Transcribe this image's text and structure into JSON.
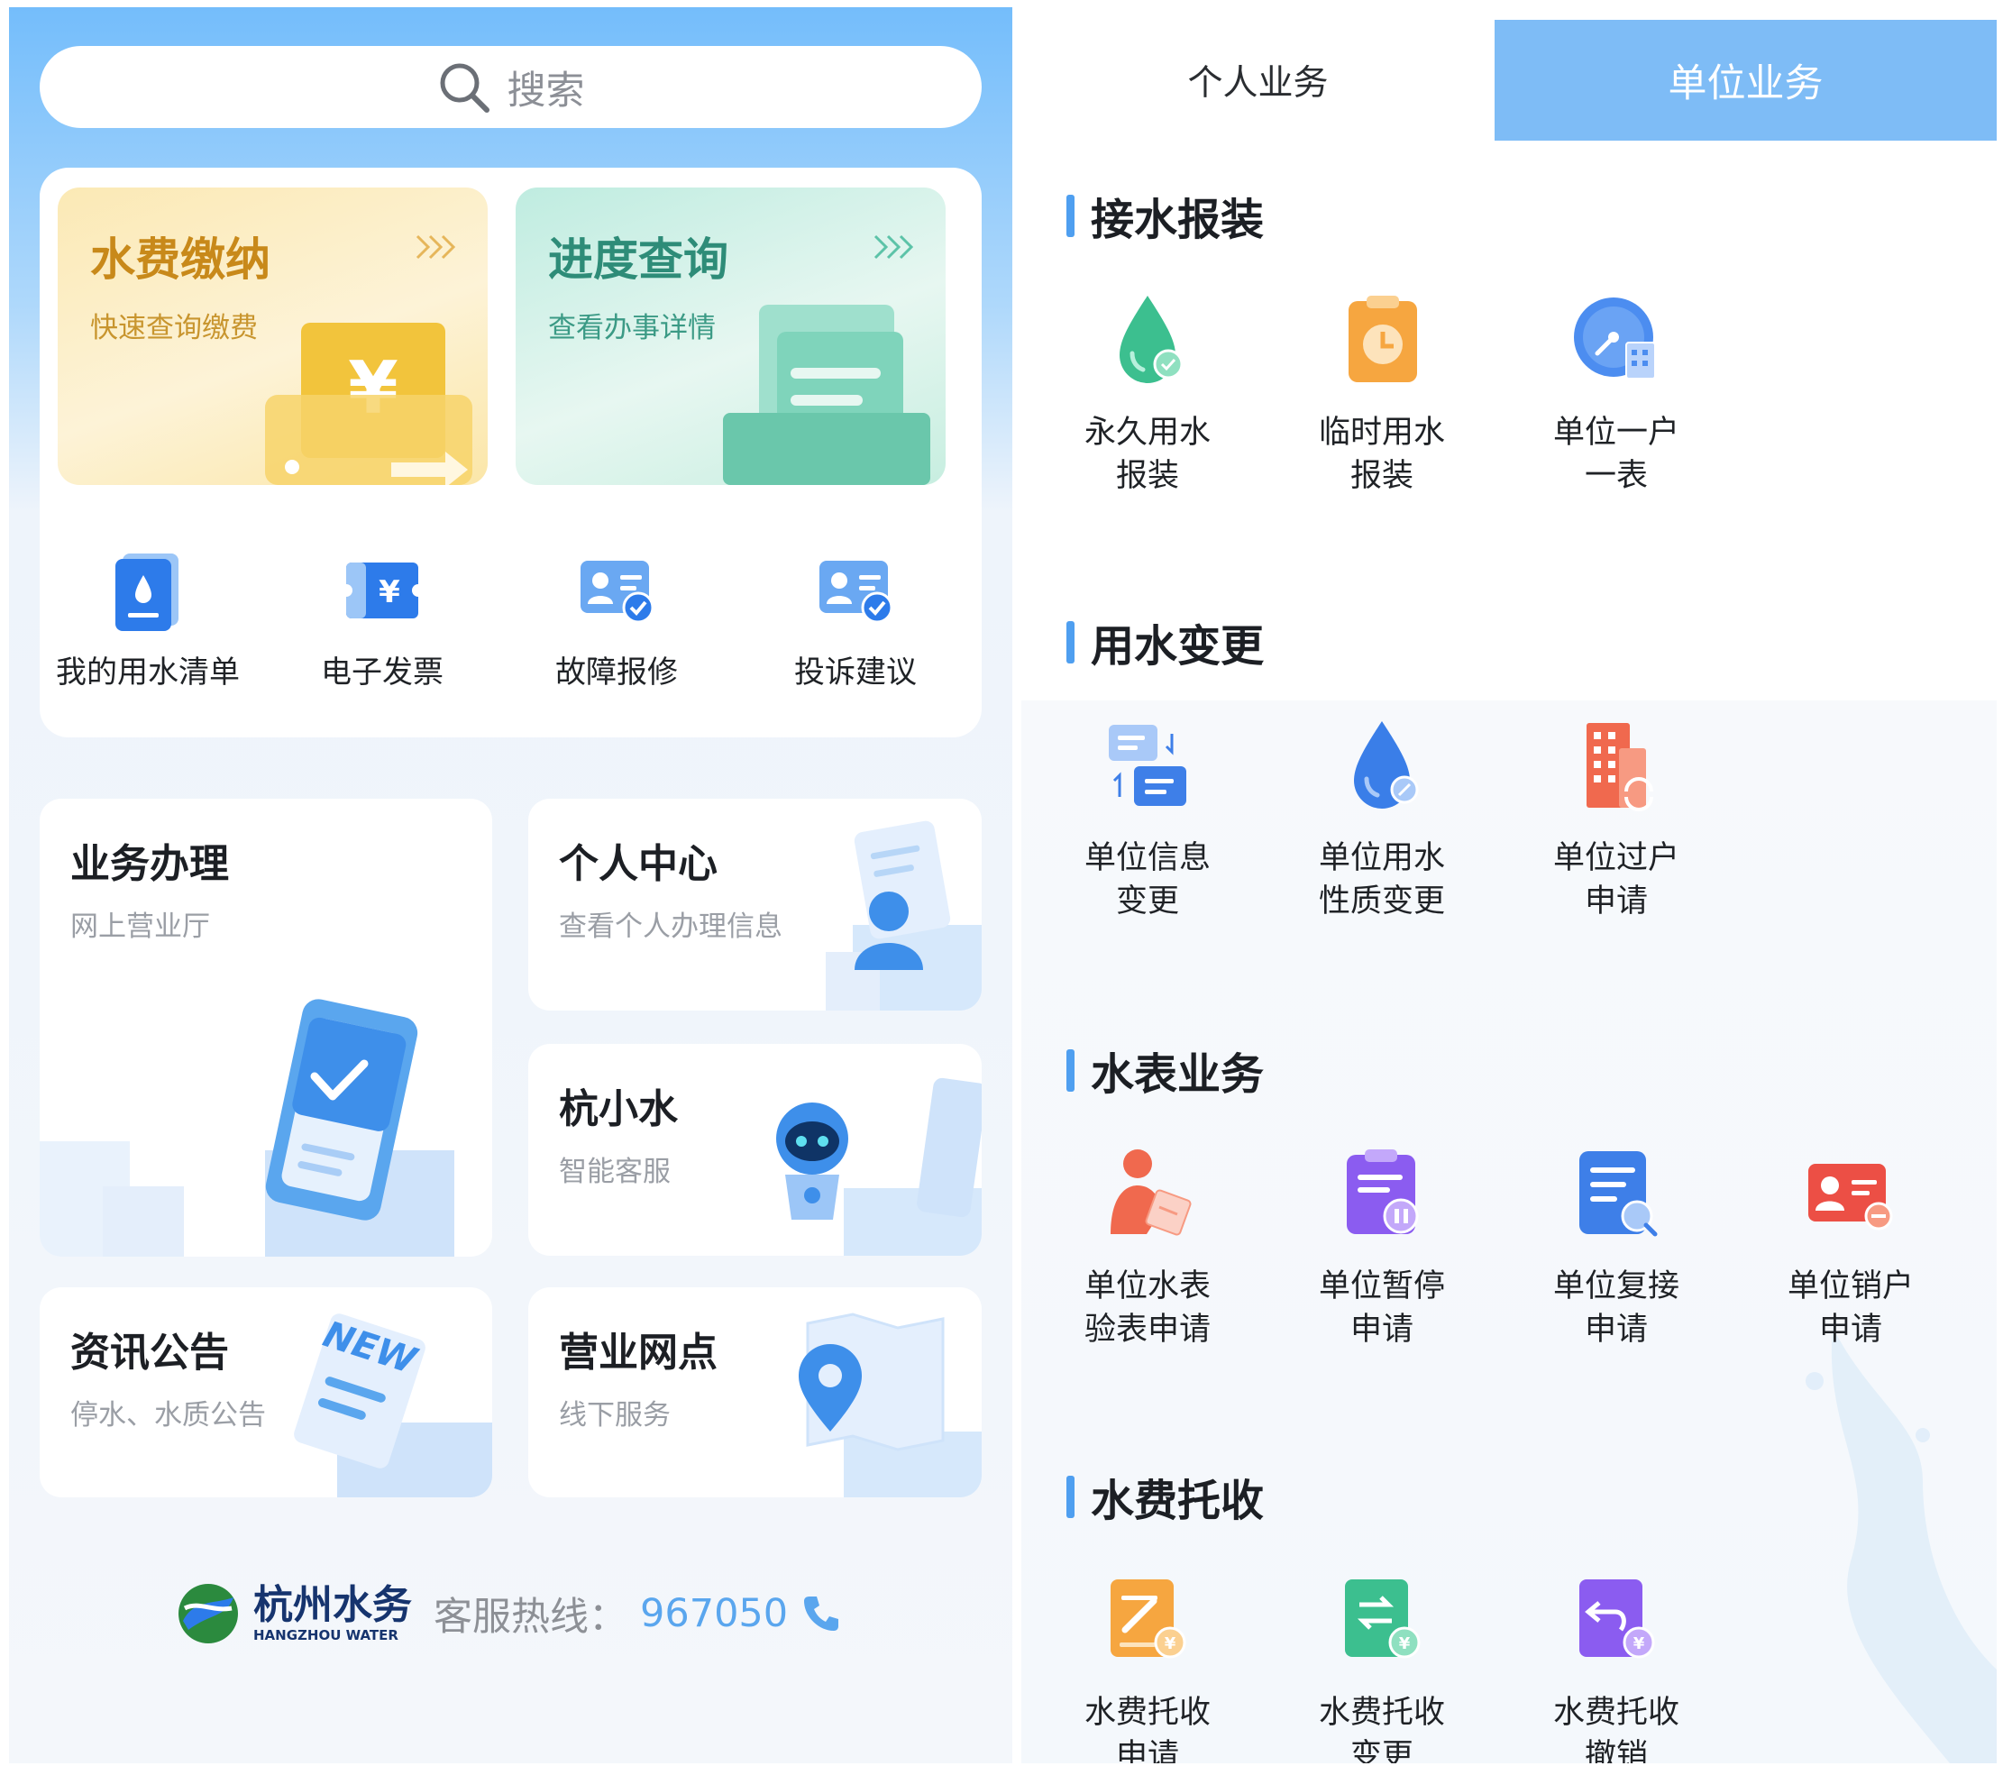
{
  "search": {
    "placeholder": "搜索"
  },
  "features": [
    {
      "title": "水费缴纳",
      "subtitle": "快速查询缴费"
    },
    {
      "title": "进度查询",
      "subtitle": "查看办事详情"
    }
  ],
  "quick_items": [
    {
      "label": "我的用水清单"
    },
    {
      "label": "电子发票"
    },
    {
      "label": "故障报修"
    },
    {
      "label": "投诉建议"
    }
  ],
  "cards": {
    "business": {
      "title": "业务办理",
      "subtitle": "网上营业厅"
    },
    "personal": {
      "title": "个人中心",
      "subtitle": "查看个人办理信息"
    },
    "assistant": {
      "title": "杭小水",
      "subtitle": "智能客服"
    },
    "news": {
      "title": "资讯公告",
      "subtitle": "停水、水质公告",
      "badge": "NEW"
    },
    "outlets": {
      "title": "营业网点",
      "subtitle": "线下服务"
    }
  },
  "footer": {
    "brand_cn": "杭州水务",
    "brand_en": "HANGZHOU WATER",
    "hotline_label": "客服热线：",
    "hotline_number": "967050"
  },
  "tabs": [
    {
      "label": "个人业务",
      "active": false
    },
    {
      "label": "单位业务",
      "active": true
    }
  ],
  "sections": [
    {
      "title": "接水报装",
      "items": [
        {
          "line1": "永久用水",
          "line2": "报装",
          "icon": "water-drop-check-icon"
        },
        {
          "line1": "临时用水",
          "line2": "报装",
          "icon": "clipboard-clock-icon"
        },
        {
          "line1": "单位一户",
          "line2": "一表",
          "icon": "meter-building-icon"
        }
      ]
    },
    {
      "title": "用水变更",
      "items": [
        {
          "line1": "单位信息",
          "line2": "变更",
          "icon": "info-transfer-icon"
        },
        {
          "line1": "单位用水",
          "line2": "性质变更",
          "icon": "water-drop-edit-icon"
        },
        {
          "line1": "单位过户",
          "line2": "申请",
          "icon": "building-transfer-icon"
        }
      ]
    },
    {
      "title": "水表业务",
      "items": [
        {
          "line1": "单位水表",
          "line2": "验表申请",
          "icon": "person-inspect-icon"
        },
        {
          "line1": "单位暂停",
          "line2": "申请",
          "icon": "clipboard-pause-icon"
        },
        {
          "line1": "单位复接",
          "line2": "申请",
          "icon": "document-search-icon"
        },
        {
          "line1": "单位销户",
          "line2": "申请",
          "icon": "id-card-minus-icon"
        }
      ]
    },
    {
      "title": "水费托收",
      "items": [
        {
          "line1": "水费托收",
          "line2": "申请",
          "icon": "bill-edit-icon"
        },
        {
          "line1": "水费托收",
          "line2": "变更",
          "icon": "bill-exchange-icon"
        },
        {
          "line1": "水费托收",
          "line2": "撤销",
          "icon": "bill-revoke-icon"
        }
      ]
    }
  ],
  "colors": {
    "accent": "#7ebcf6",
    "section_bar": "#4f9ff0",
    "hotline": "#5aa6ee",
    "pay_title": "#c8891a",
    "progress_title": "#2e8c78"
  }
}
